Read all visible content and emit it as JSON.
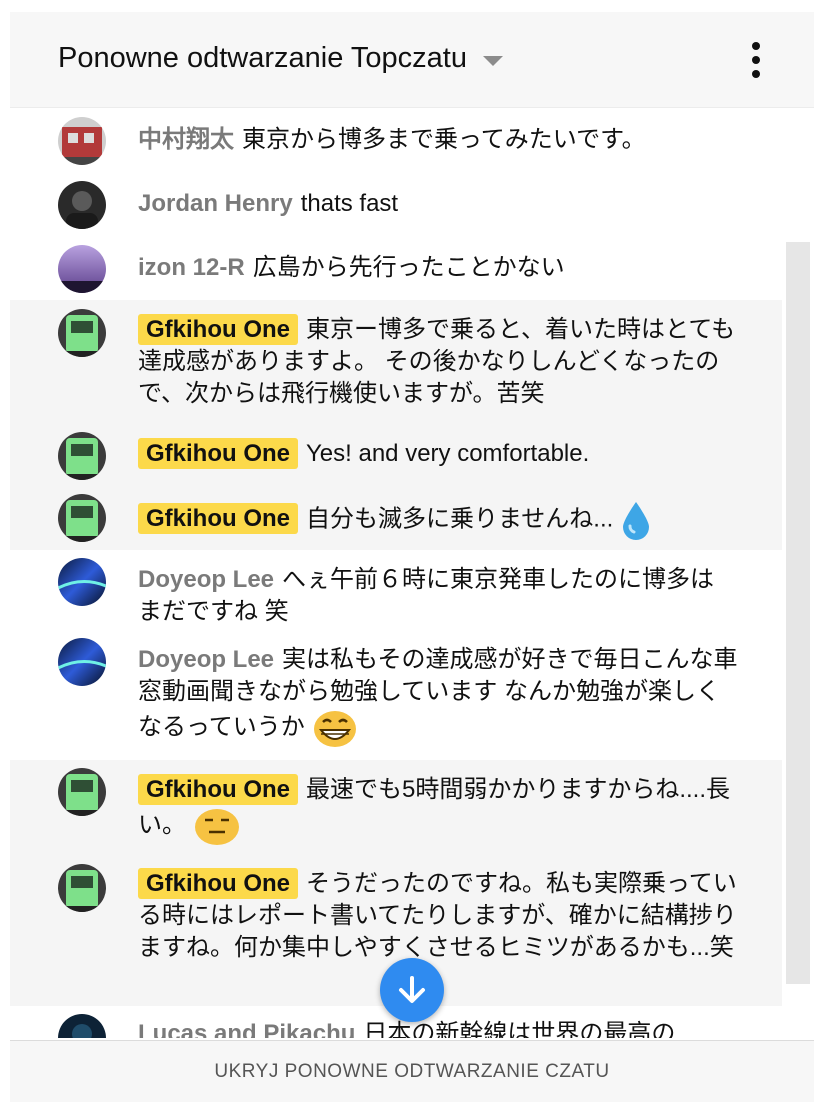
{
  "header": {
    "title": "Ponowne odtwarzanie Topczatu"
  },
  "messages": [
    {
      "author": "中村翔太",
      "text": "東京から博多まで乗ってみたいです。",
      "owner": false,
      "avatar": "train-red"
    },
    {
      "author": "Jordan Henry",
      "text": "thats fast",
      "owner": false,
      "avatar": "person-dark"
    },
    {
      "author": "izon 12-R",
      "text": "広島から先行ったことかない",
      "owner": false,
      "avatar": "purple-sky"
    },
    {
      "author": "Gfkihou One",
      "text": "東京ー博多で乗ると、着いた時はとても達成感がありますよ。 その後かなりしんどくなったので、次からは飛行機使いますが。苦笑",
      "owner": true,
      "avatar": "train-green"
    },
    {
      "author": "Gfkihou One",
      "text": "Yes! and very comfortable.",
      "owner": true,
      "avatar": "train-green"
    },
    {
      "author": "Gfkihou One",
      "text": "自分も滅多に乗りませんね...",
      "owner": true,
      "avatar": "train-green",
      "emoji": "droplet-icon"
    },
    {
      "author": "Doyeop Lee",
      "text": "へぇ午前６時に東京発車したのに博多はまだですね 笑",
      "owner": false,
      "avatar": "aurora"
    },
    {
      "author": "Doyeop Lee",
      "text": "実は私もその達成感が好きで毎日こんな車窓動画聞きながら勉強しています なんか勉強が楽しくなるっていうか",
      "owner": false,
      "avatar": "aurora",
      "emoji": "grin-emoji"
    },
    {
      "author": "Gfkihou One",
      "text": "最速でも5時間弱かかりますからね....長い。",
      "owner": true,
      "avatar": "train-green",
      "emoji": "expressionless-emoji"
    },
    {
      "author": "Gfkihou One",
      "text": "そうだったのですね。私も実際乗っている時にはレポート書いてたりしますが、確かに結構捗りますね。何か集中しやすくさせるヒミツがあるかも...笑",
      "owner": true,
      "avatar": "train-green"
    },
    {
      "author": "Lucas and Pikachu",
      "text": "日本の新幹線は世界の最高の",
      "owner": false,
      "avatar": "night"
    }
  ],
  "footer": {
    "label": "UKRYJ PONOWNE ODTWARZANIE CZATU"
  },
  "colors": {
    "owner_badge": "#fcd94a",
    "scroll_button": "#2f8bf0"
  }
}
